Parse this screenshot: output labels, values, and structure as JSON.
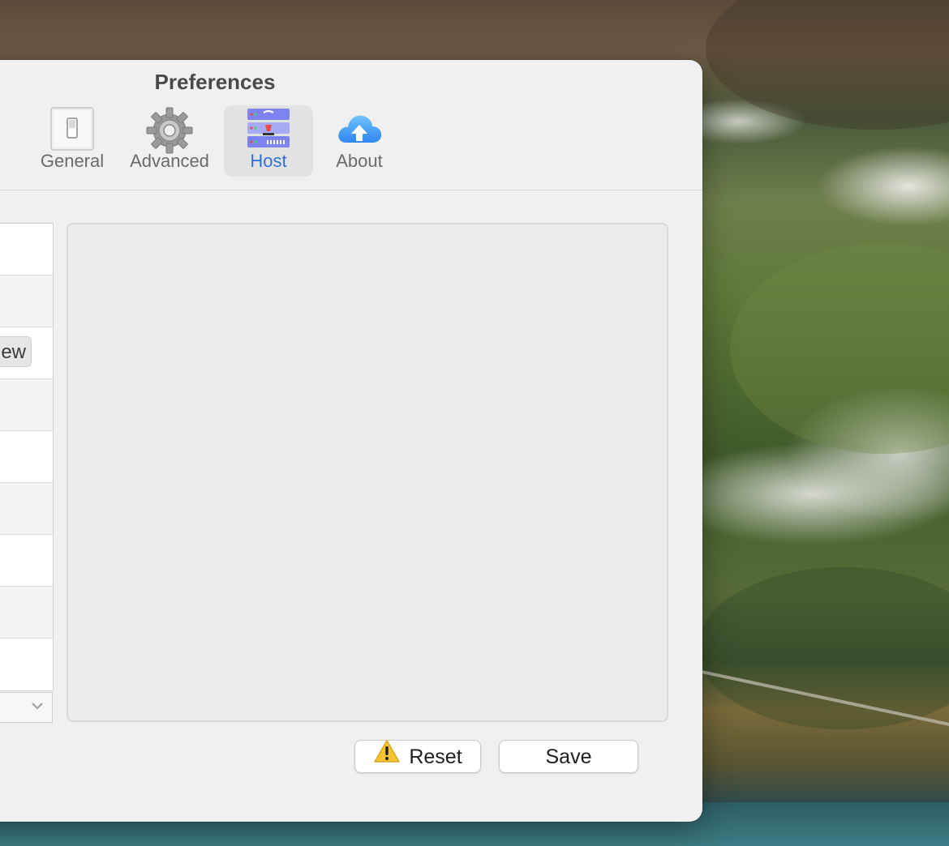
{
  "window": {
    "title": "Preferences"
  },
  "toolbar": {
    "tabs": [
      {
        "label": "General",
        "icon": "switch-icon",
        "active": false
      },
      {
        "label": "Advanced",
        "icon": "gear-icon",
        "active": false
      },
      {
        "label": "Host",
        "icon": "server-icon",
        "active": true
      },
      {
        "label": "About",
        "icon": "cloud-upload-icon",
        "active": false
      }
    ]
  },
  "host_list": {
    "view_button_label": "ew"
  },
  "footer": {
    "reset_label": "Reset",
    "save_label": "Save"
  },
  "colors": {
    "accent": "#2f6fe0",
    "window_bg": "#f0f0f0"
  }
}
